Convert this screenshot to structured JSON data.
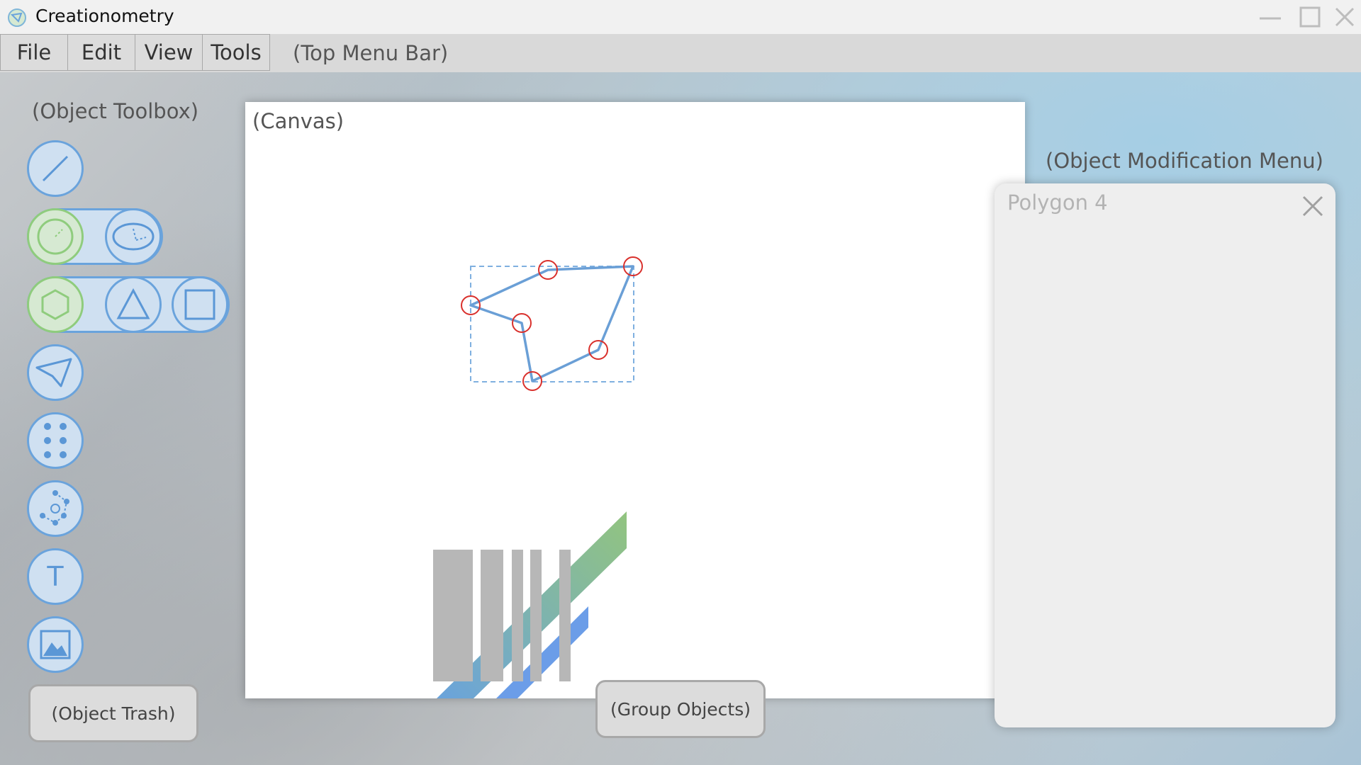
{
  "window": {
    "title": "Creationometry"
  },
  "menu": {
    "items": [
      "File",
      "Edit",
      "View",
      "Tools"
    ],
    "annotation": "(Top Menu Bar)"
  },
  "toolbox": {
    "annotation": "(Object Toolbox)",
    "tools": [
      {
        "name": "line-tool",
        "icon": "line-icon"
      },
      {
        "name": "circle-tool",
        "icon": "circle-icon",
        "selected": true
      },
      {
        "name": "ellipse-tool",
        "icon": "ellipse-icon"
      },
      {
        "name": "hexagon-tool",
        "icon": "hexagon-icon",
        "selected": true
      },
      {
        "name": "triangle-tool",
        "icon": "triangle-icon"
      },
      {
        "name": "square-tool",
        "icon": "square-icon"
      },
      {
        "name": "polygon-tool",
        "icon": "polygon-icon"
      },
      {
        "name": "points-tool",
        "icon": "points-icon"
      },
      {
        "name": "rotation-tool",
        "icon": "rotation-icon"
      },
      {
        "name": "text-tool",
        "icon": "text-icon"
      },
      {
        "name": "image-tool",
        "icon": "image-icon"
      }
    ]
  },
  "trash": {
    "label": "(Object Trash)"
  },
  "canvas": {
    "annotation": "(Canvas)"
  },
  "group": {
    "label": "(Group Objects)"
  },
  "modification": {
    "annotation": "(Object Modification Menu)",
    "panel_title": "Polygon 4"
  },
  "colors": {
    "tool_border": "#6aa3dc",
    "tool_fill": "#cfe0f1",
    "selected_border": "#8fcc7d",
    "vertex_handle": "#d9302c",
    "polygon_stroke": "#6a9fd6"
  },
  "text_tool_glyph": "T"
}
